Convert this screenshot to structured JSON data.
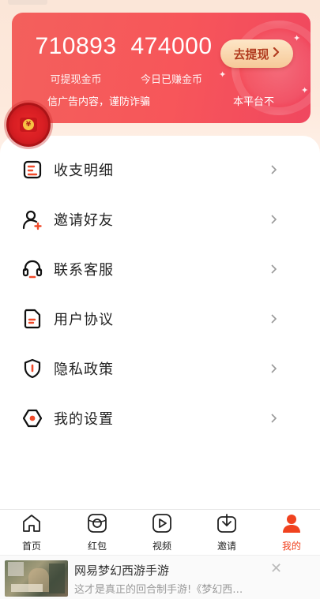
{
  "wallet": {
    "withdrawable_coins": "710893",
    "withdrawable_label": "可提现金币",
    "earned_today": "474000",
    "earned_today_label": "今日已赚金币",
    "withdraw_button": "去提现",
    "marquee_left": "信广告内容，谨防诈骗",
    "marquee_right": "本平台不"
  },
  "red_packet": {
    "symbol": "¥"
  },
  "menu": {
    "items": [
      {
        "label": "收支明细",
        "icon": "ledger-icon"
      },
      {
        "label": "邀请好友",
        "icon": "invite-user-icon"
      },
      {
        "label": "联系客服",
        "icon": "headset-icon"
      },
      {
        "label": "用户协议",
        "icon": "document-icon"
      },
      {
        "label": "隐私政策",
        "icon": "shield-icon"
      },
      {
        "label": "我的设置",
        "icon": "settings-icon"
      }
    ]
  },
  "tabbar": {
    "items": [
      {
        "label": "首页",
        "icon": "home-icon"
      },
      {
        "label": "红包",
        "icon": "red-packet-icon"
      },
      {
        "label": "视频",
        "icon": "video-icon"
      },
      {
        "label": "邀请",
        "icon": "invite-icon"
      },
      {
        "label": "我的",
        "icon": "profile-icon"
      }
    ],
    "active": "我的"
  },
  "ad": {
    "title": "网易梦幻西游手游",
    "subtitle": "这才是真正的回合制手游!《梦幻西…",
    "close": "✕"
  },
  "colors": {
    "accent": "#f0421f",
    "card": "#f3605c",
    "button": "#f6c998"
  }
}
